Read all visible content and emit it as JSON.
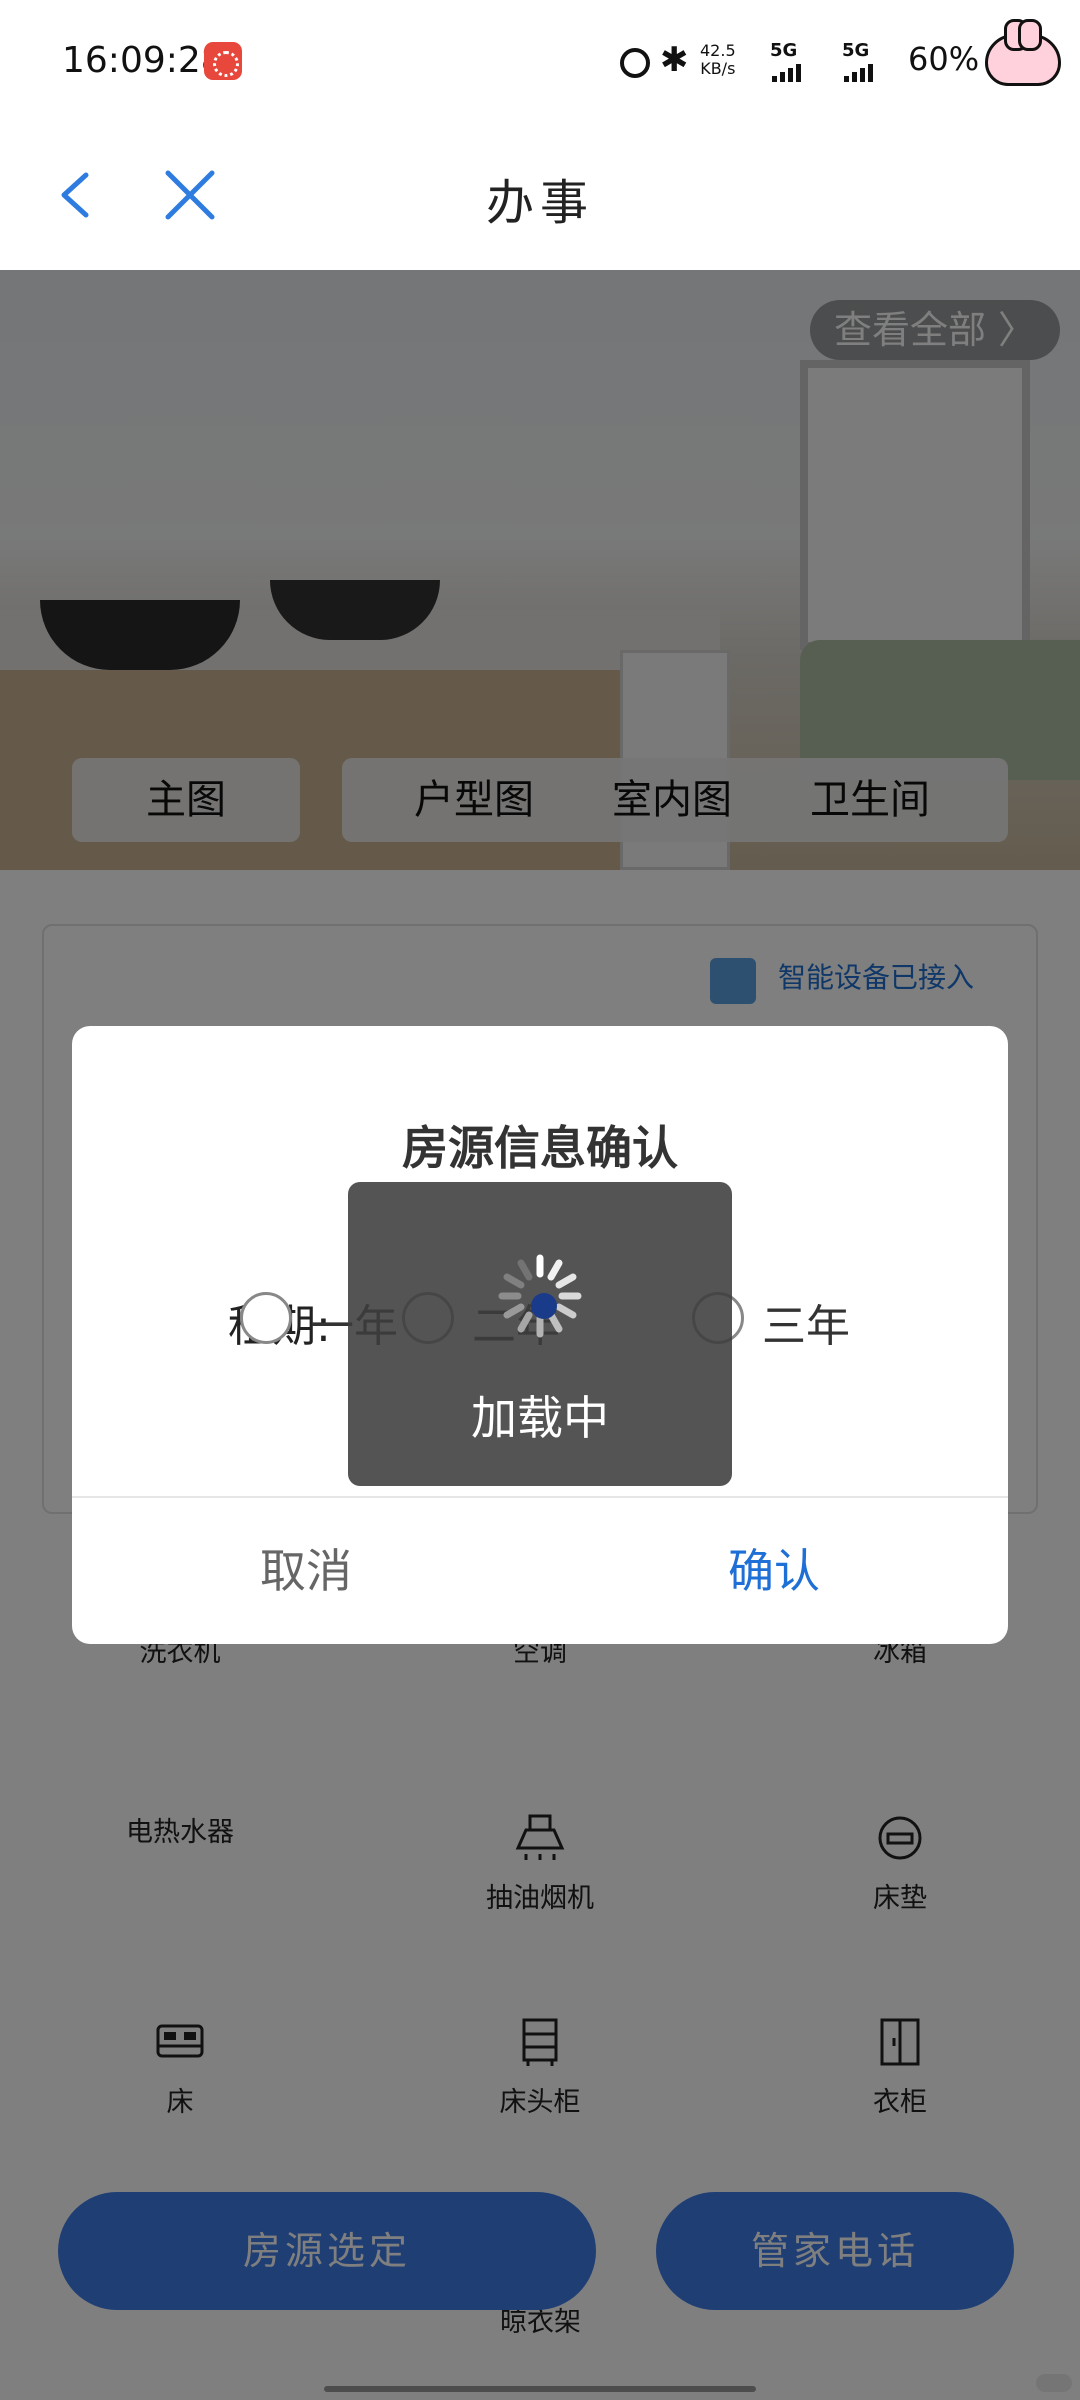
{
  "status_bar": {
    "time": "16:09:28",
    "speed_value": "42.5",
    "speed_unit": "KB/s",
    "network_1": "5G",
    "network_2": "5G",
    "battery": "60%"
  },
  "nav": {
    "title": "办事",
    "back_icon": "chevron-left-icon",
    "close_icon": "close-icon"
  },
  "hero": {
    "view_all": "查看全部 〉",
    "tabs": [
      "主图",
      "户型图",
      "室内图",
      "卫生间"
    ]
  },
  "smart_device": "智能设备已接入",
  "facilities": [
    {
      "label": "洗衣机",
      "icon": "washing-machine-icon"
    },
    {
      "label": "空调",
      "icon": "air-conditioner-icon"
    },
    {
      "label": "冰箱",
      "icon": "fridge-icon"
    },
    {
      "label": "电热水器",
      "icon": "water-heater-icon"
    },
    {
      "label": "抽油烟机",
      "icon": "range-hood-icon"
    },
    {
      "label": "床垫",
      "icon": "mattress-icon"
    },
    {
      "label": "床",
      "icon": "bed-icon"
    },
    {
      "label": "床头柜",
      "icon": "nightstand-icon"
    },
    {
      "label": "衣柜",
      "icon": "wardrobe-icon"
    },
    {
      "label": "晾衣架",
      "icon": "clothes-rack-icon"
    }
  ],
  "bottom_buttons": {
    "select": "房源选定",
    "phone": "管家电话"
  },
  "dialog": {
    "title": "房源信息确认",
    "lease_label": "租期:",
    "options": [
      "一年",
      "二年",
      "三年"
    ],
    "cancel": "取消",
    "confirm": "确认"
  },
  "loading": {
    "text": "加载中"
  },
  "colors": {
    "accent": "#1e6fd6",
    "button_blue": "#3f7de8",
    "overlay": "rgba(0,0,0,0.5)"
  }
}
